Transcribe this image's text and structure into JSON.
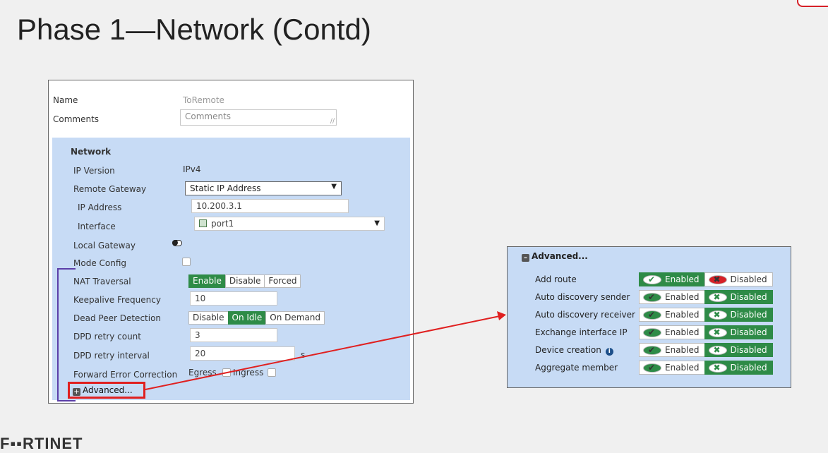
{
  "slide": {
    "title": "Phase 1—Network (Contd)"
  },
  "logo": {
    "text": "F▪▪RTINET"
  },
  "form": {
    "name_label": "Name",
    "name_value": "ToRemote",
    "comments_label": "Comments",
    "comments_placeholder": "Comments",
    "network": {
      "heading": "Network",
      "ip_version_label": "IP Version",
      "ip_version_value": "IPv4",
      "remote_gateway_label": "Remote Gateway",
      "remote_gateway_value": "Static IP Address",
      "ip_address_label": "IP Address",
      "ip_address_value": "10.200.3.1",
      "interface_label": "Interface",
      "interface_value": "port1",
      "local_gateway_label": "Local Gateway",
      "mode_config_label": "Mode Config",
      "nat_traversal_label": "NAT Traversal",
      "nat_traversal_options": [
        "Enable",
        "Disable",
        "Forced"
      ],
      "nat_traversal_selected": "Enable",
      "keepalive_label": "Keepalive Frequency",
      "keepalive_value": "10",
      "dpd_label": "Dead Peer Detection",
      "dpd_options": [
        "Disable",
        "On Idle",
        "On Demand"
      ],
      "dpd_selected": "On Idle",
      "dpd_retry_count_label": "DPD retry count",
      "dpd_retry_count_value": "3",
      "dpd_retry_interval_label": "DPD retry interval",
      "dpd_retry_interval_value": "20",
      "dpd_retry_interval_unit": "s",
      "fec_label": "Forward Error Correction",
      "fec_egress_label": "Egress",
      "fec_ingress_label": "Ingress",
      "advanced_label": "Advanced..."
    }
  },
  "advanced_panel": {
    "heading": "Advanced...",
    "enabled_label": "Enabled",
    "disabled_label": "Disabled",
    "rows": [
      {
        "label": "Add route",
        "state": "Enabled"
      },
      {
        "label": "Auto discovery sender",
        "state": "Disabled"
      },
      {
        "label": "Auto discovery receiver",
        "state": "Disabled"
      },
      {
        "label": "Exchange interface IP",
        "state": "Disabled"
      },
      {
        "label": "Device creation",
        "state": "Disabled",
        "info": true
      },
      {
        "label": "Aggregate member",
        "state": "Disabled"
      }
    ]
  },
  "colors": {
    "panel_bg": "#c7dbf5",
    "enabled_green": "#2e8b47",
    "highlight_red": "#e02020",
    "bracket_purple": "#5b3fa8"
  }
}
